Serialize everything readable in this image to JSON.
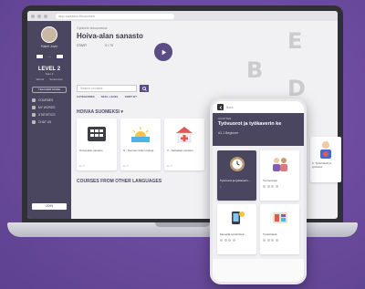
{
  "browser": {
    "url": "app.sanasto.fi/courses"
  },
  "sidebar": {
    "user_name": "Rakel Jovin",
    "level_label": "LEVEL 2",
    "level_sub": "Taso 2",
    "stat_words": "Words",
    "stat_sentences": "Sentences",
    "teacher_label": "TEACHER MODE",
    "nav": [
      {
        "label": "COURSES"
      },
      {
        "label": "MY WORDS"
      },
      {
        "label": "STATISTICS"
      },
      {
        "label": "CHAT US"
      }
    ],
    "join_label": "JOIN"
  },
  "main": {
    "breadcrumb": "Opiskele alasanastoa",
    "course_title": "Hoiva-alan sanasto",
    "start_label": "START",
    "progress_label": "0 / 70",
    "search_placeholder": "Search courses",
    "filters": [
      "CATEGORIES",
      "SKILL LEVEL",
      "SORT BY"
    ],
    "section_title": "HOIVAA SUOMEKSI",
    "cards": [
      {
        "name": "Hoiva-alan sanasto",
        "footer": "0 / 7"
      },
      {
        "name": "S - Suomen kielen taitoja",
        "footer": "0 / 7"
      },
      {
        "name": "V - Sairaalan sanasto",
        "footer": "0 / 7"
      }
    ],
    "other_title": "COURSES FROM OTHER LANGUAGES"
  },
  "phone": {
    "top_label": "Back",
    "chapter_label": "CHAPTER",
    "chapter_title": "Työvuorot ja työkaverin ke",
    "level_label": "A1.1 Beginner",
    "cards": [
      {
        "name": "Työvuorot ja työkaverin...",
        "active": true,
        "badge": "1"
      },
      {
        "name": "Työmenojat",
        "active": false,
        "badge": ""
      },
      {
        "name": "Meneillä työtehtäviä",
        "active": false,
        "badge": ""
      },
      {
        "name": "Työtehtävät",
        "active": false,
        "badge": ""
      }
    ]
  },
  "peek_card": {
    "name": "K. Työtehtävät ja työrutiinit"
  },
  "colors": {
    "brand": "#4a4660",
    "accent": "#5b4c84",
    "background": "#6a4a9c"
  }
}
